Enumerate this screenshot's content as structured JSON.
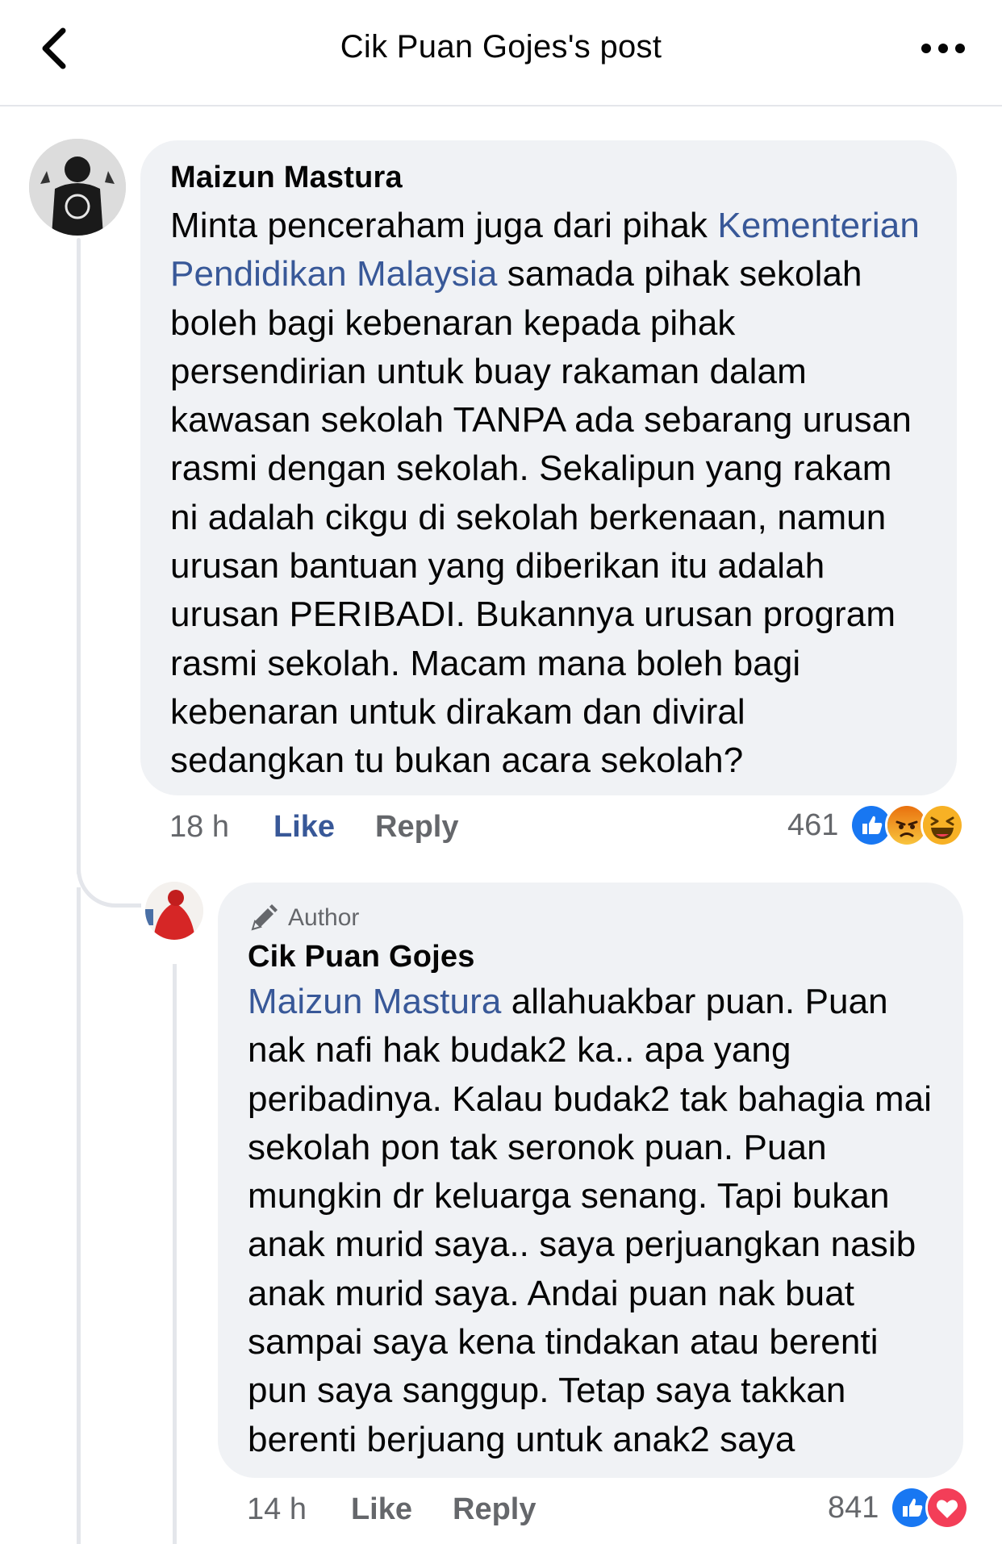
{
  "header": {
    "title": "Cik Puan Gojes's post",
    "back_icon": "chevron-left-icon",
    "more_icon": "more-horizontal-icon"
  },
  "comment": {
    "author": "Maizun Mastura",
    "text_before": "Minta penceraham juga dari pihak ",
    "mention": "Kementerian Pendidikan Malaysia",
    "text_after": " samada pihak sekolah boleh bagi kebenaran kepada pihak persendirian untuk buay rakaman dalam kawasan sekolah TANPA ada sebarang urusan rasmi dengan sekolah. Sekalipun yang rakam ni adalah cikgu di sekolah berkenaan, namun urusan bantuan yang diberikan itu adalah urusan PERIBADI. Bukannya urusan program rasmi sekolah. Macam mana boleh bagi kebenaran untuk dirakam dan diviral sedangkan tu bukan acara sekolah?",
    "time": "18 h",
    "like_label": "Like",
    "reply_label": "Reply",
    "reaction_count": "461",
    "reactions": [
      "like",
      "angry",
      "haha"
    ]
  },
  "reply": {
    "badge": "Author",
    "author": "Cik Puan Gojes",
    "mention": "Maizun Mastura",
    "text_after": " allahuakbar puan. Puan nak nafi hak budak2 ka.. apa yang peribadinya. Kalau budak2 tak bahagia mai sekolah pon tak seronok puan. Puan mungkin dr keluarga senang. Tapi bukan anak murid saya.. saya perjuangkan nasib anak murid saya. Andai puan nak buat sampai saya kena tindakan atau berenti pun saya sanggup. Tetap saya takkan berenti berjuang untuk anak2 saya",
    "time": "14 h",
    "like_label": "Like",
    "reply_label": "Reply",
    "reaction_count": "841",
    "reactions": [
      "like",
      "love"
    ]
  },
  "colors": {
    "link": "#385898",
    "bubble": "#f0f2f5",
    "meta": "#65676b",
    "like_reaction": "#1877f2",
    "love_reaction": "#f33e58",
    "angry_reaction": "#e9710f",
    "haha_reaction": "#f7b125"
  }
}
